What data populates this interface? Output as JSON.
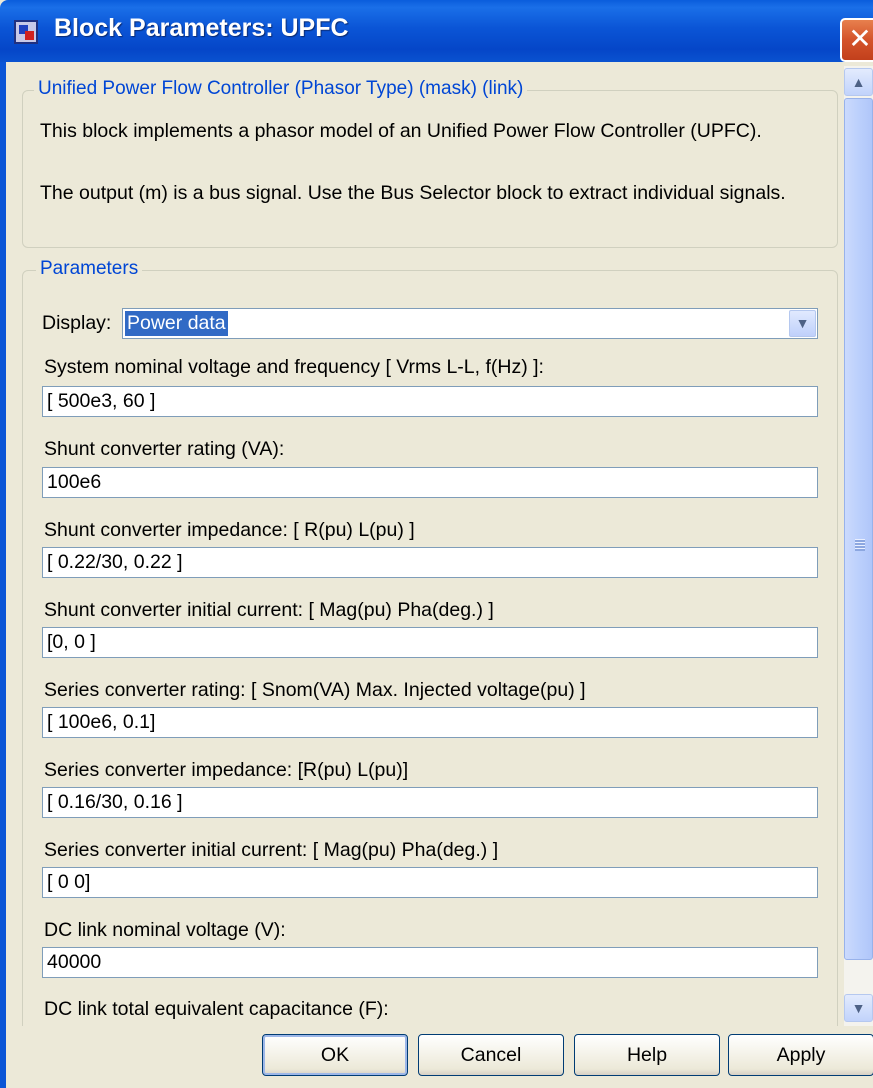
{
  "window": {
    "title": "Block Parameters: UPFC",
    "close_glyph": "✕"
  },
  "description": {
    "legend": "Unified Power Flow Controller (Phasor Type) (mask) (link)",
    "line1": "This block implements a phasor model of an Unified Power Flow Controller (UPFC).",
    "line2": "The output (m) is a bus signal. Use the Bus Selector block to extract individual signals."
  },
  "parameters": {
    "legend": "Parameters",
    "display_label": "Display:",
    "display_value": "Power data",
    "fields": [
      {
        "label": "System nominal voltage and frequency [ Vrms L-L, f(Hz) ]:",
        "value": "[ 500e3, 60 ]"
      },
      {
        "label": "Shunt converter rating (VA):",
        "value": "100e6"
      },
      {
        "label": "Shunt converter impedance: [ R(pu)  L(pu) ]",
        "value": "[ 0.22/30, 0.22 ]"
      },
      {
        "label": "Shunt converter initial current: [ Mag(pu)  Pha(deg.) ]",
        "value": "[0, 0 ]"
      },
      {
        "label": "Series converter rating: [ Snom(VA)   Max. Injected voltage(pu) ]",
        "value": "[ 100e6, 0.1]"
      },
      {
        "label": "Series  converter impedance: [R(pu)  L(pu)]",
        "value": "[ 0.16/30, 0.16 ]"
      },
      {
        "label": "Series converter initial current: [ Mag(pu)  Pha(deg.) ]",
        "value": "[ 0 0]"
      },
      {
        "label": "DC link nominal voltage (V):",
        "value": "40000"
      },
      {
        "label": "DC link total equivalent capacitance (F):",
        "value": ""
      }
    ]
  },
  "buttons": {
    "ok": "OK",
    "cancel": "Cancel",
    "help": "Help",
    "apply": "Apply"
  },
  "icons": {
    "app": "simulink-block-icon",
    "close": "close-icon",
    "scroll_up": "scroll-up-arrow-icon",
    "scroll_down": "scroll-down-arrow-icon",
    "dropdown": "chevron-down-icon"
  }
}
